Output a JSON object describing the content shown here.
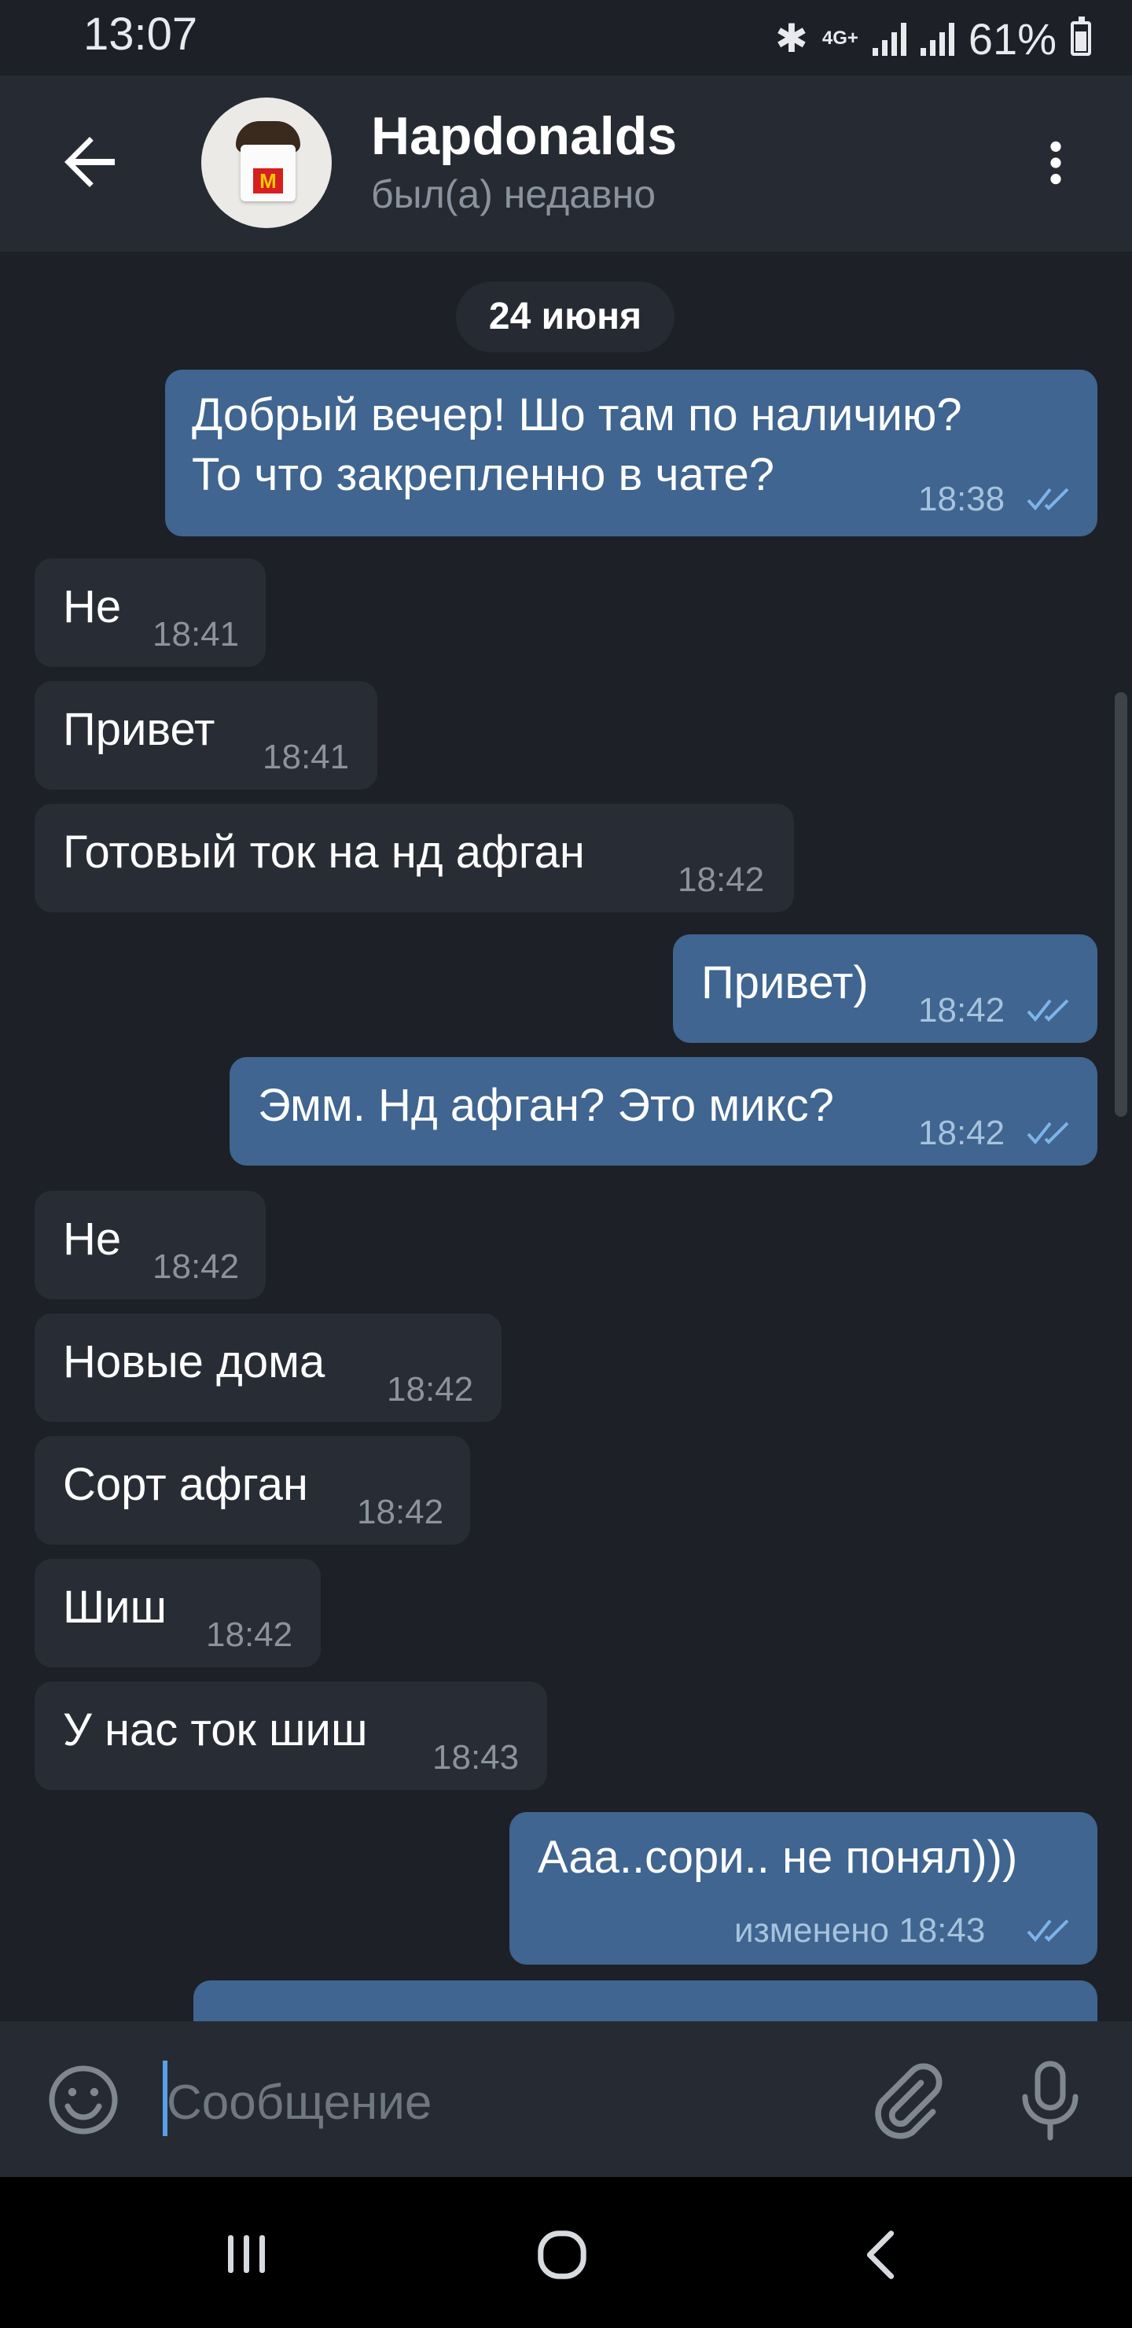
{
  "status_bar": {
    "time": "13:07",
    "network_label": "4G+",
    "battery": "61%"
  },
  "header": {
    "contact_name": "Hapdonalds",
    "status": "был(а) недавно",
    "avatar_logo_text": "M"
  },
  "chat": {
    "date": "24 июня",
    "messages": [
      {
        "dir": "out",
        "text": "Добрый вечер! Шо там по наличию?",
        "text2": "То что закрепленно в чате?",
        "time": "18:38",
        "read": true
      },
      {
        "dir": "in",
        "text": "Не",
        "time": "18:41"
      },
      {
        "dir": "in",
        "text": "Привет",
        "time": "18:41"
      },
      {
        "dir": "in",
        "text": "Готовый ток на нд афган",
        "time": "18:42"
      },
      {
        "dir": "out",
        "text": "Привет)",
        "time": "18:42",
        "read": true
      },
      {
        "dir": "out",
        "text": "Эмм. Нд афган? Это микс?",
        "time": "18:42",
        "read": true
      },
      {
        "dir": "in",
        "text": "Не",
        "time": "18:42"
      },
      {
        "dir": "in",
        "text": "Новые дома",
        "time": "18:42"
      },
      {
        "dir": "in",
        "text": "Сорт афган",
        "time": "18:42"
      },
      {
        "dir": "in",
        "text": "Шиш",
        "time": "18:42"
      },
      {
        "dir": "in",
        "text": "У нас ток шиш",
        "time": "18:43"
      },
      {
        "dir": "out",
        "text": "Ааа..сори.. не понял)))",
        "time": "изменено 18:43",
        "read": true
      }
    ]
  },
  "composer": {
    "placeholder": "Сообщение"
  },
  "colors": {
    "background": "#1d2026",
    "header": "#262b33",
    "incoming_bubble": "#282d35",
    "outgoing_bubble": "#3f6590",
    "accent": "#5aa0e6"
  },
  "icons": [
    "back-arrow-icon",
    "more-vert-icon",
    "emoji-icon",
    "attach-icon",
    "mic-icon",
    "bluetooth-icon",
    "signal-icon",
    "battery-icon",
    "nav-recent-icon",
    "nav-home-icon",
    "nav-back-icon",
    "double-check-icon"
  ]
}
